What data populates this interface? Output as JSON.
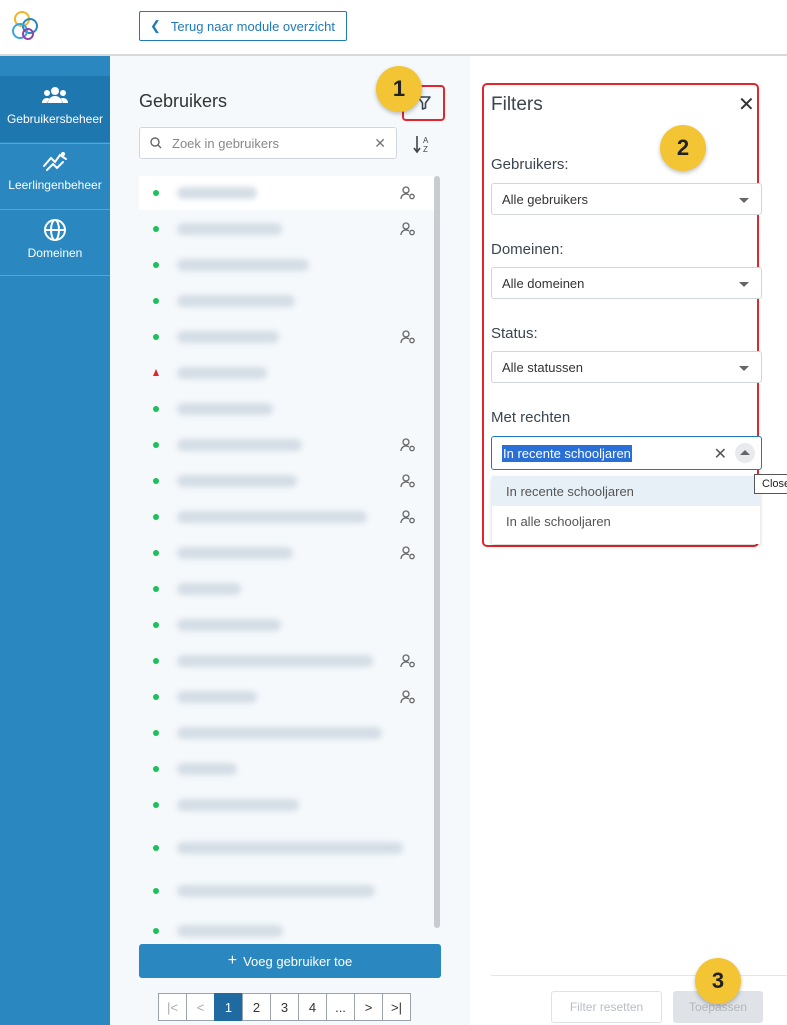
{
  "topbar": {
    "back_label": "Terug naar module overzicht"
  },
  "sidebar": {
    "items": [
      {
        "label": "Gebruikersbeheer",
        "icon": "users-icon",
        "active": true
      },
      {
        "label": "Leerlingenbeheer",
        "icon": "student-management-icon",
        "active": false
      },
      {
        "label": "Domeinen",
        "icon": "globe-icon",
        "active": false
      }
    ]
  },
  "users": {
    "title": "Gebruikers",
    "search_placeholder": "Zoek in gebruikers",
    "add_label": "Voeg gebruiker toe",
    "rows": [
      {
        "status": "active",
        "has_user_icon": true
      },
      {
        "status": "active",
        "has_user_icon": true
      },
      {
        "status": "active",
        "has_user_icon": false
      },
      {
        "status": "active",
        "has_user_icon": false
      },
      {
        "status": "active",
        "has_user_icon": true
      },
      {
        "status": "warning",
        "has_user_icon": false
      },
      {
        "status": "active",
        "has_user_icon": false
      },
      {
        "status": "active",
        "has_user_icon": true
      },
      {
        "status": "active",
        "has_user_icon": true
      },
      {
        "status": "active",
        "has_user_icon": true
      },
      {
        "status": "active",
        "has_user_icon": true
      },
      {
        "status": "active",
        "has_user_icon": false
      },
      {
        "status": "active",
        "has_user_icon": false
      },
      {
        "status": "active",
        "has_user_icon": true
      },
      {
        "status": "active",
        "has_user_icon": true
      },
      {
        "status": "active",
        "has_user_icon": false
      },
      {
        "status": "active",
        "has_user_icon": false
      },
      {
        "status": "active",
        "has_user_icon": false
      },
      {
        "status": "active",
        "has_user_icon": false
      },
      {
        "status": "active",
        "has_user_icon": false
      },
      {
        "status": "active",
        "has_user_icon": false
      }
    ],
    "pagination": {
      "pages": [
        "1",
        "2",
        "3",
        "4",
        "..."
      ],
      "current": "1",
      "first": "|<",
      "prev": "<",
      "next": ">",
      "last": ">|"
    }
  },
  "filters": {
    "title": "Filters",
    "users_label": "Gebruikers:",
    "users_value": "Alle gebruikers",
    "domains_label": "Domeinen:",
    "domains_value": "Alle domeinen",
    "status_label": "Status:",
    "status_value": "Alle statussen",
    "rights_label": "Met rechten",
    "rights_value": "In recente schooljaren",
    "rights_options": [
      "In recente schooljaren",
      "In alle schooljaren"
    ],
    "tooltip": "Close",
    "reset_label": "Filter resetten",
    "apply_label": "Toepassen"
  },
  "annotations": {
    "step1": "1",
    "step2": "2",
    "step3": "3"
  },
  "colors": {
    "sidebar": "#2a87c0",
    "accent": "#1f7ab8",
    "highlight_border": "#e3262d",
    "badge": "#f3c433",
    "status_active": "#1bc15a",
    "status_warning": "#e3262d"
  }
}
